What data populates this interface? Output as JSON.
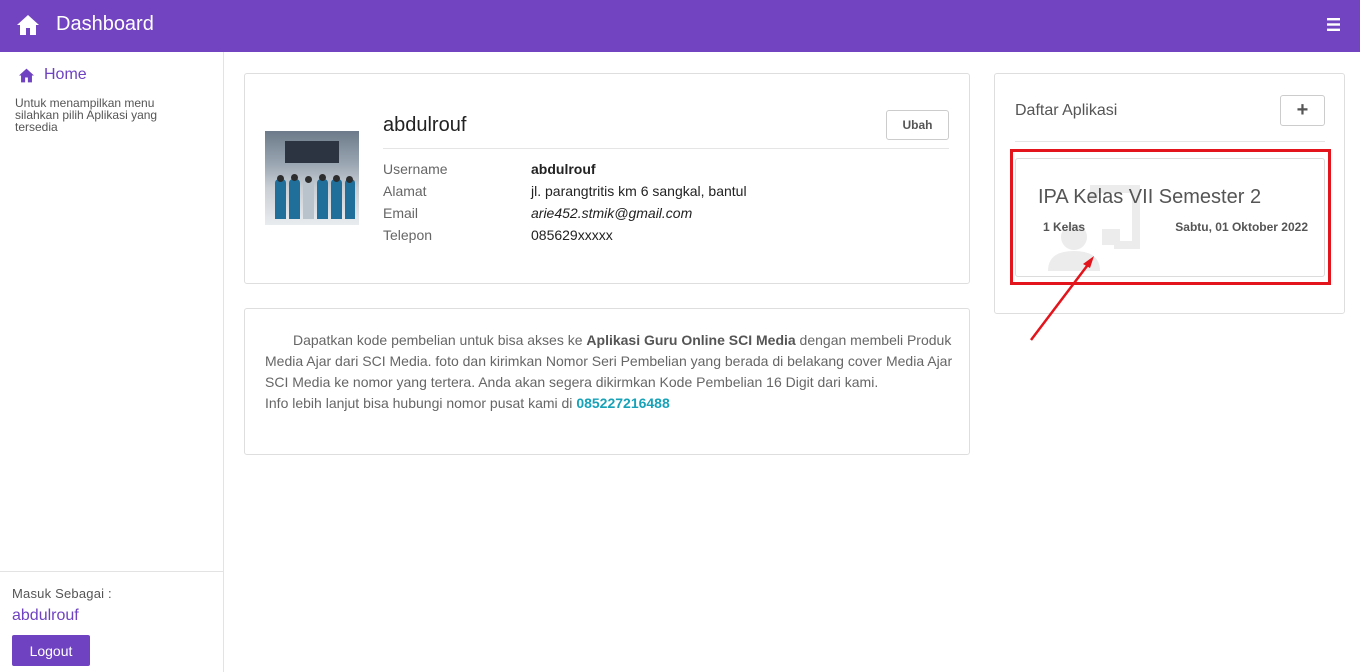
{
  "topbar": {
    "title": "Dashboard",
    "bg": "#7344c1"
  },
  "sidebar": {
    "home_label": "Home",
    "hint": "Untuk menampilkan menu silahkan pilih Aplikasi yang tersedia",
    "login_label": "Masuk Sebagai :",
    "user": "abdulrouf",
    "logout_label": "Logout"
  },
  "profile": {
    "name": "abdulrouf",
    "edit_label": "Ubah",
    "fields": [
      {
        "label": "Username",
        "value": "abdulrouf"
      },
      {
        "label": "Alamat",
        "value": "jl. parangtritis km 6 sangkal, bantul"
      },
      {
        "label": "Email",
        "value": "arie452.stmik@gmail.com"
      },
      {
        "label": "Telepon",
        "value": "085629xxxxx"
      }
    ]
  },
  "promo": {
    "part1": "Dapatkan kode pembelian untuk bisa akses ke ",
    "app_name": "Aplikasi Guru Online SCI Media",
    "part2": " dengan membeli Produk Media Ajar dari SCI Media. foto dan kirimkan Nomor Seri Pembelian yang berada di belakang cover Media Ajar SCI Media ke nomor yang tertera. Anda akan segera dikirmkan Kode Pembelian 16 Digit dari kami.",
    "info": "Info lebih lanjut bisa hubungi nomor pusat kami di ",
    "phone": "085227216488"
  },
  "apps": {
    "title": "Daftar Aplikasi",
    "add_label": "+",
    "items": [
      {
        "title": "IPA Kelas VII Semester 2",
        "count": "1 Kelas",
        "date": "Sabtu, 01 Oktober 2022"
      }
    ]
  },
  "colors": {
    "accent": "#6f42c1",
    "highlight": "#e3141b",
    "link": "#17a2b8"
  }
}
